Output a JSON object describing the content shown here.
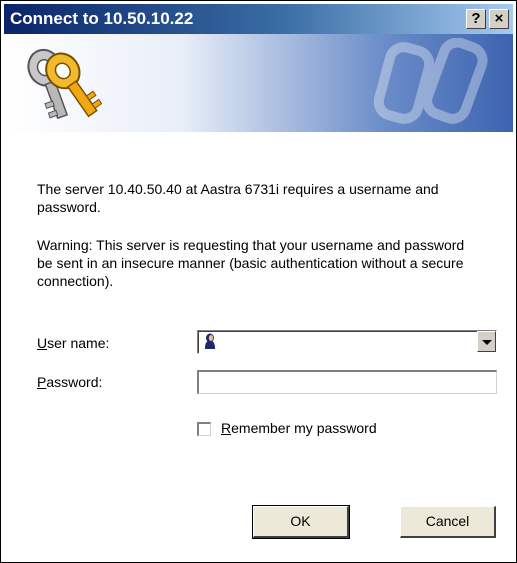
{
  "window": {
    "title": "Connect to 10.50.10.22",
    "help_button": "?",
    "close_button": "×"
  },
  "message": {
    "line1": "The server 10.40.50.40 at Aastra 6731i requires a username and password.",
    "warning": "Warning: This server is requesting that your username and password be sent in an insecure manner (basic authentication without a secure connection)."
  },
  "form": {
    "username": {
      "label_first": "U",
      "label_rest": "ser name:",
      "value": ""
    },
    "password": {
      "label_first": "P",
      "label_rest": "assword:",
      "value": ""
    },
    "remember": {
      "label_first": "R",
      "label_rest": "emember my password",
      "checked": false
    }
  },
  "buttons": {
    "ok": "OK",
    "cancel": "Cancel"
  },
  "colors": {
    "titlebar_start": "#0a246a",
    "titlebar_end": "#a6caf0",
    "dialog_bg": "#ffffff"
  },
  "icons": {
    "banner": "keys-icon",
    "username_field": "user-icon"
  }
}
